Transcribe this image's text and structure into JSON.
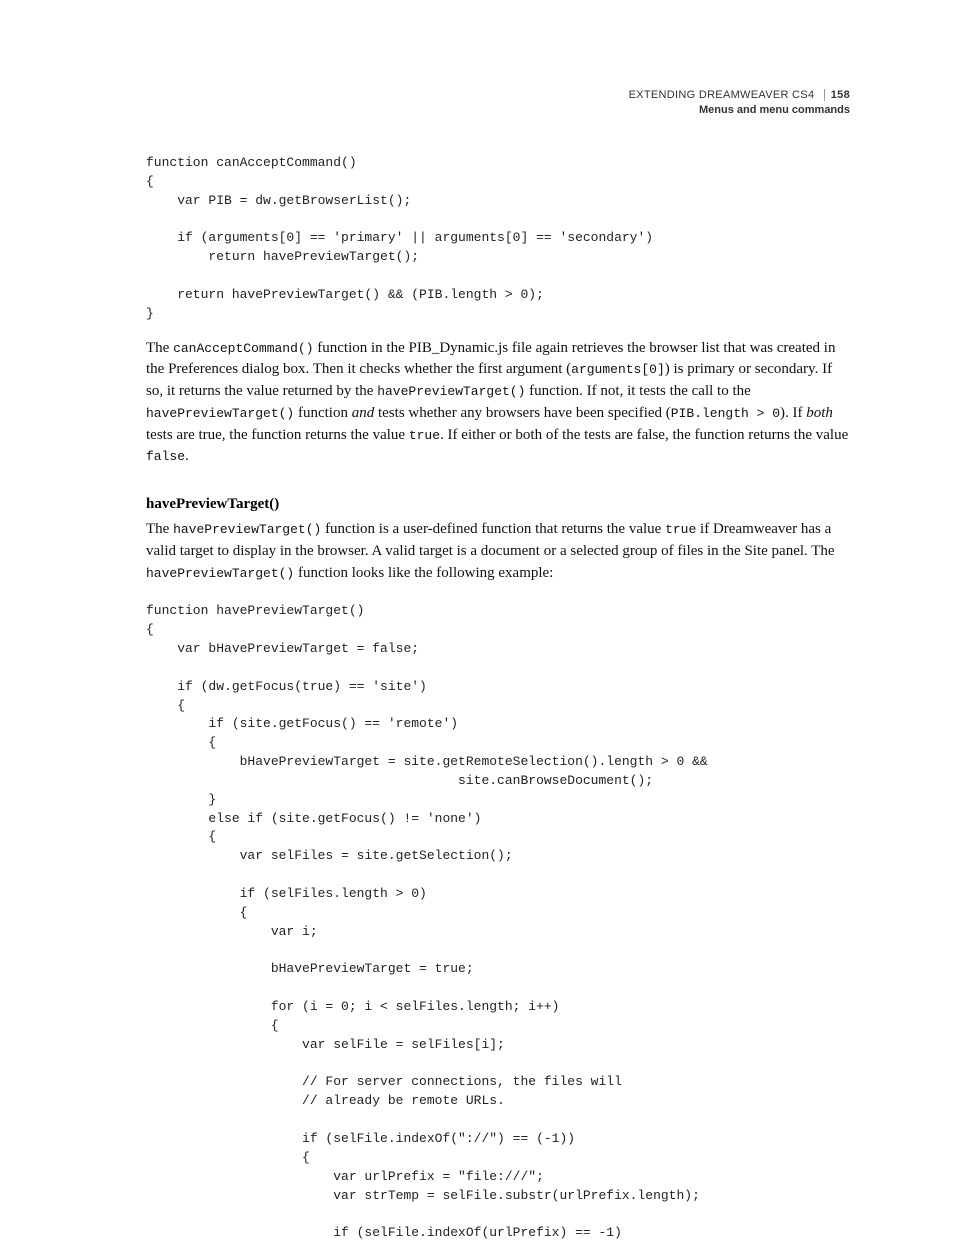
{
  "header": {
    "doc_title": "EXTENDING DREAMWEAVER CS4",
    "page_number": "158",
    "section": "Menus and menu commands"
  },
  "code_block_1": "function canAcceptCommand()\n{\n    var PIB = dw.getBrowserList();\n\n    if (arguments[0] == 'primary' || arguments[0] == 'secondary')\n        return havePreviewTarget();\n\n    return havePreviewTarget() && (PIB.length > 0);\n}",
  "para1": {
    "t1": "The ",
    "c1": "canAcceptCommand()",
    "t2": " function in the PIB_Dynamic.js file again retrieves the browser list that was created in the Preferences dialog box. Then it checks whether the first argument (",
    "c2": "arguments[0]",
    "t3": ") is primary or secondary. If so, it returns the value returned by the ",
    "c3": "havePreviewTarget()",
    "t4": " function. If not, it tests the call to the ",
    "c4": "havePreviewTarget()",
    "t5": " function ",
    "e1": "and",
    "t6": " tests whether any browsers have been specified (",
    "c5": "PIB.length > 0",
    "t7": "). If ",
    "e2": "both",
    "t8": " tests are true, the function returns the value ",
    "c6": "true",
    "t9": ". If either or both of the tests are false, the function returns the value ",
    "c7": "false",
    "t10": "."
  },
  "subhead": "havePreviewTarget()",
  "para2": {
    "t1": "The ",
    "c1": "havePreviewTarget()",
    "t2": " function is a user-defined function that returns the value ",
    "c2": "true",
    "t3": " if Dreamweaver has a valid target to display in the browser. A valid target is a document or a selected group of files in the Site panel. The ",
    "c3": "havePreviewTarget()",
    "t4": " function looks like the following example:"
  },
  "code_block_2": "function havePreviewTarget()\n{\n    var bHavePreviewTarget = false;\n\n    if (dw.getFocus(true) == 'site')\n    {\n        if (site.getFocus() == 'remote')\n        {\n            bHavePreviewTarget = site.getRemoteSelection().length > 0 &&\n                                        site.canBrowseDocument();\n        }\n        else if (site.getFocus() != 'none')\n        {\n            var selFiles = site.getSelection();\n\n            if (selFiles.length > 0)\n            {\n                var i;\n\n                bHavePreviewTarget = true;\n\n                for (i = 0; i < selFiles.length; i++)\n                {\n                    var selFile = selFiles[i];\n\n                    // For server connections, the files will\n                    // already be remote URLs.\n\n                    if (selFile.indexOf(\"://\") == (-1))\n                    {\n                        var urlPrefix = \"file:///\";\n                        var strTemp = selFile.substr(urlPrefix.length);\n\n                        if (selFile.indexOf(urlPrefix) == -1)"
}
